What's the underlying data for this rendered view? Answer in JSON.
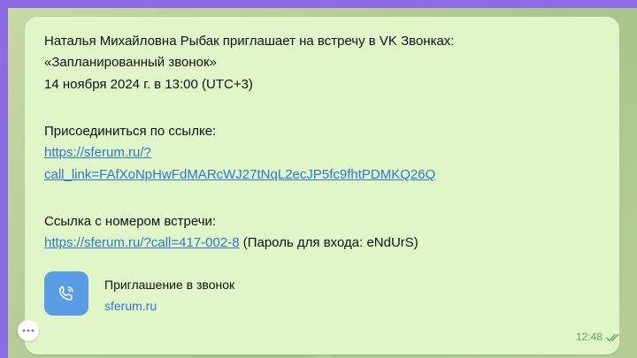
{
  "message": {
    "line1": "Наталья Михайловна Рыбак приглашает на встречу в VK Звонках:",
    "line2": "«Запланированный звонок»",
    "line3": "14 ноября 2024 г. в 13:00 (UTC+3)",
    "join_label": "Присоединиться по ссылке:",
    "join_link_part1": "https://sferum.ru/?",
    "join_link_part2": "call_link=FAfXoNpHwFdMARcWJ27tNqL2ecJP5fc9fhtPDMKQ26Q",
    "number_label": "Ссылка с номером встречи:",
    "number_link": "https://sferum.ru/?call=417-002-8",
    "password_text": " (Пароль для входа: eNdUrS)"
  },
  "preview": {
    "icon": "phone-call-icon",
    "title": "Приглашение в звонок",
    "domain": "sferum.ru"
  },
  "meta": {
    "time": "12:48",
    "status_icon": "double-check-icon"
  },
  "colors": {
    "outer_bg": "#8d6ce6",
    "bubble": "#e0f5c8",
    "link": "#2e78c9",
    "preview_icon_bg": "#5b9de2",
    "time": "#59a86a"
  }
}
